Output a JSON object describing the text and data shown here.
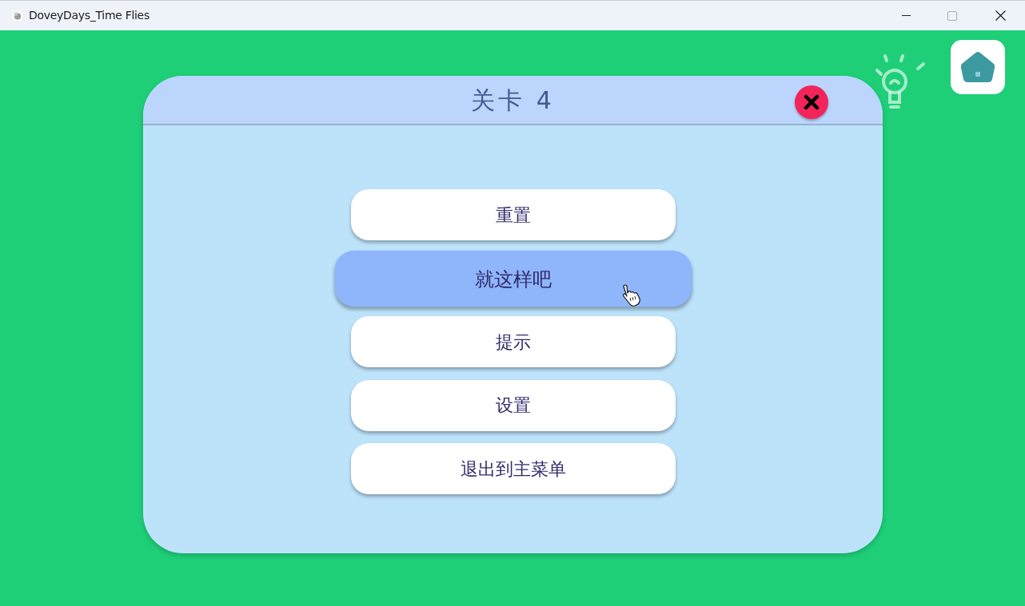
{
  "window": {
    "title": "DoveyDays_Time Flies"
  },
  "dialog": {
    "title": "关卡 4",
    "menu": [
      {
        "label": "重置",
        "highlighted": false
      },
      {
        "label": "就这样吧",
        "highlighted": true
      },
      {
        "label": "提示",
        "highlighted": false
      },
      {
        "label": "设置",
        "highlighted": false
      },
      {
        "label": "退出到主菜单",
        "highlighted": false
      }
    ]
  }
}
